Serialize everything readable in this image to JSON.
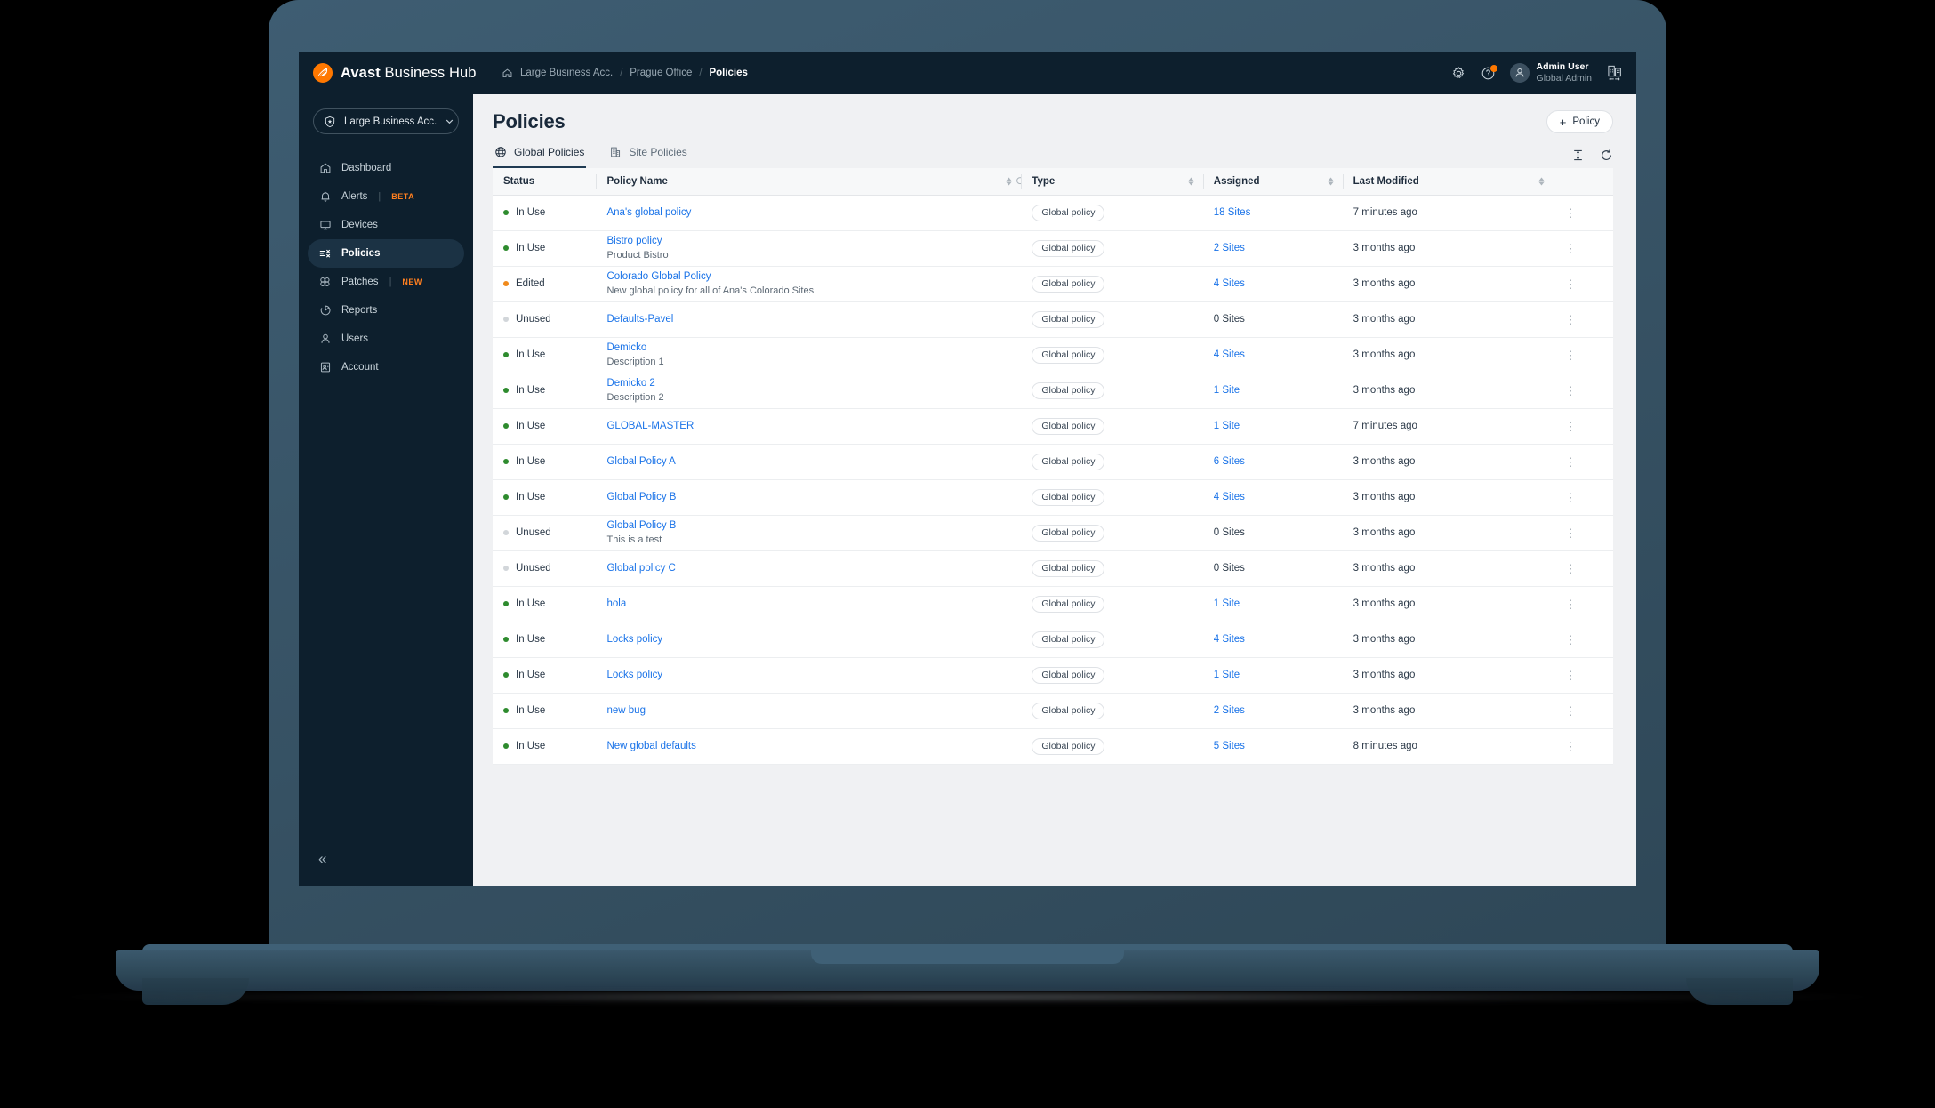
{
  "brand": {
    "name_bold": "Avast",
    "name_rest": " Business Hub",
    "logo_icon": "avast-logo-icon"
  },
  "breadcrumb": {
    "home_icon": "home-icon",
    "items": [
      "Large Business Acc.",
      "Prague Office",
      "Policies"
    ],
    "separator": "/"
  },
  "topbar": {
    "settings_icon": "gear-icon",
    "help_icon": "help-circle-icon",
    "avatar_icon": "user-avatar-icon",
    "user_name": "Admin User",
    "user_role": "Global Admin",
    "switch_icon": "building-switch-icon"
  },
  "sidebar": {
    "account_selector": {
      "label": "Large Business Acc.",
      "icon": "shield-check-icon",
      "chevron": "chevron-down-icon"
    },
    "items": [
      {
        "label": "Dashboard",
        "icon": "home-icon",
        "active": false,
        "badge": ""
      },
      {
        "label": "Alerts",
        "icon": "bell-icon",
        "active": false,
        "badge": "BETA"
      },
      {
        "label": "Devices",
        "icon": "monitor-icon",
        "active": false,
        "badge": ""
      },
      {
        "label": "Policies",
        "icon": "policies-icon",
        "active": true,
        "badge": ""
      },
      {
        "label": "Patches",
        "icon": "patches-icon",
        "active": false,
        "badge": "NEW"
      },
      {
        "label": "Reports",
        "icon": "pie-chart-icon",
        "active": false,
        "badge": ""
      },
      {
        "label": "Users",
        "icon": "user-icon",
        "active": false,
        "badge": ""
      },
      {
        "label": "Account",
        "icon": "account-card-icon",
        "active": false,
        "badge": ""
      }
    ],
    "collapse_icon": "chevron-double-left-icon",
    "collapse_glyph": "«"
  },
  "main": {
    "page_title": "Policies",
    "add_button": {
      "label": "Policy",
      "plus": "+",
      "icon": "plus-icon"
    },
    "tabs": [
      {
        "label": "Global Policies",
        "icon": "globe-icon",
        "active": true
      },
      {
        "label": "Site Policies",
        "icon": "building-icon",
        "active": false
      }
    ],
    "tools": [
      {
        "name": "text-format-icon"
      },
      {
        "name": "refresh-icon"
      }
    ]
  },
  "table": {
    "columns": [
      {
        "key": "status",
        "label": "Status",
        "sortable": false,
        "search": false
      },
      {
        "key": "name",
        "label": "Policy Name",
        "sortable": true,
        "search": true
      },
      {
        "key": "type",
        "label": "Type",
        "sortable": true,
        "search": false
      },
      {
        "key": "assigned",
        "label": "Assigned",
        "sortable": true,
        "search": false
      },
      {
        "key": "modified",
        "label": "Last Modified",
        "sortable": true,
        "search": false
      }
    ],
    "rows": [
      {
        "status": "In Use",
        "dot": "inuse",
        "name": "Ana's global policy",
        "desc": "",
        "type": "Global policy",
        "assigned": "18 Sites",
        "assigned_link": true,
        "modified": "7 minutes ago"
      },
      {
        "status": "In Use",
        "dot": "inuse",
        "name": "Bistro policy",
        "desc": "Product Bistro",
        "type": "Global policy",
        "assigned": "2 Sites",
        "assigned_link": true,
        "modified": "3 months ago"
      },
      {
        "status": "Edited",
        "dot": "edited",
        "name": "Colorado Global Policy",
        "desc": "New global policy for all of Ana's Colorado Sites",
        "type": "Global policy",
        "assigned": "4 Sites",
        "assigned_link": true,
        "modified": "3 months ago"
      },
      {
        "status": "Unused",
        "dot": "unused",
        "name": "Defaults-Pavel",
        "desc": "",
        "type": "Global policy",
        "assigned": "0 Sites",
        "assigned_link": false,
        "modified": "3 months ago"
      },
      {
        "status": "In Use",
        "dot": "inuse",
        "name": "Demicko",
        "desc": "Description 1",
        "type": "Global policy",
        "assigned": "4 Sites",
        "assigned_link": true,
        "modified": "3 months ago"
      },
      {
        "status": "In Use",
        "dot": "inuse",
        "name": "Demicko 2",
        "desc": "Description 2",
        "type": "Global policy",
        "assigned": "1 Site",
        "assigned_link": true,
        "modified": "3 months ago"
      },
      {
        "status": "In Use",
        "dot": "inuse",
        "name": "GLOBAL-MASTER",
        "desc": "",
        "type": "Global policy",
        "assigned": "1 Site",
        "assigned_link": true,
        "modified": "7 minutes ago"
      },
      {
        "status": "In Use",
        "dot": "inuse",
        "name": "Global Policy A",
        "desc": "",
        "type": "Global policy",
        "assigned": "6 Sites",
        "assigned_link": true,
        "modified": "3 months ago"
      },
      {
        "status": "In Use",
        "dot": "inuse",
        "name": "Global Policy B",
        "desc": "",
        "type": "Global policy",
        "assigned": "4 Sites",
        "assigned_link": true,
        "modified": "3 months ago"
      },
      {
        "status": "Unused",
        "dot": "unused",
        "name": "Global Policy B",
        "desc": "This is a test",
        "type": "Global policy",
        "assigned": "0 Sites",
        "assigned_link": false,
        "modified": "3 months ago"
      },
      {
        "status": "Unused",
        "dot": "unused",
        "name": "Global policy C",
        "desc": "",
        "type": "Global policy",
        "assigned": "0 Sites",
        "assigned_link": false,
        "modified": "3 months ago"
      },
      {
        "status": "In Use",
        "dot": "inuse",
        "name": "hola",
        "desc": "",
        "type": "Global policy",
        "assigned": "1 Site",
        "assigned_link": true,
        "modified": "3 months ago"
      },
      {
        "status": "In Use",
        "dot": "inuse",
        "name": "Locks policy",
        "desc": "",
        "type": "Global policy",
        "assigned": "4 Sites",
        "assigned_link": true,
        "modified": "3 months ago"
      },
      {
        "status": "In Use",
        "dot": "inuse",
        "name": "Locks policy",
        "desc": "",
        "type": "Global policy",
        "assigned": "1 Site",
        "assigned_link": true,
        "modified": "3 months ago"
      },
      {
        "status": "In Use",
        "dot": "inuse",
        "name": "new bug",
        "desc": "",
        "type": "Global policy",
        "assigned": "2 Sites",
        "assigned_link": true,
        "modified": "3 months ago"
      },
      {
        "status": "In Use",
        "dot": "inuse",
        "name": "New global defaults",
        "desc": "",
        "type": "Global policy",
        "assigned": "5 Sites",
        "assigned_link": true,
        "modified": "8 minutes ago"
      }
    ],
    "row_menu_icon": "kebab-menu-icon",
    "row_menu_glyph": "⋮"
  },
  "colors": {
    "brand_orange": "#ff7800",
    "nav_dark": "#0d1f2d",
    "nav_active": "#1b3244",
    "link_blue": "#1a73e8",
    "status_inuse": "#2e8b2e",
    "status_edited": "#f08a1c",
    "status_unused": "#d2d6da",
    "page_bg": "#f0f1f3",
    "laptop_bezel": "#3a586c"
  }
}
